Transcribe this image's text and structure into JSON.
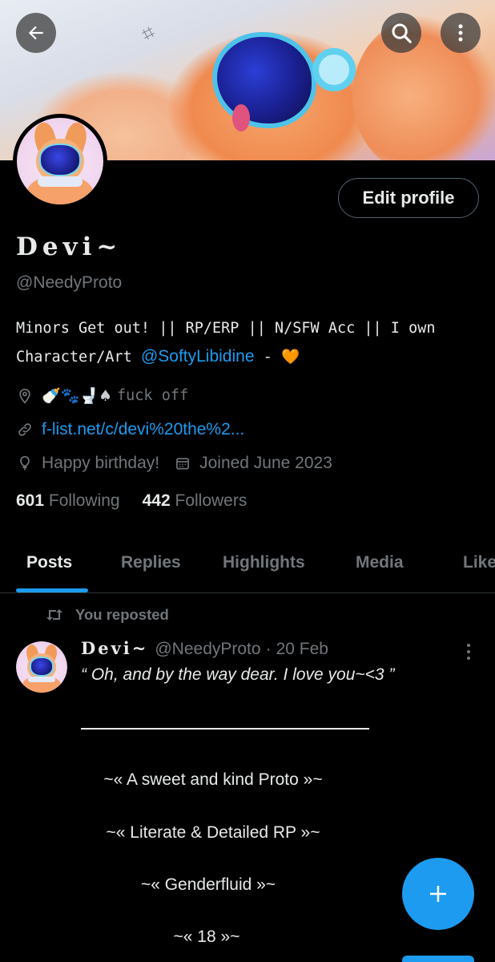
{
  "profile": {
    "display_name": "Devi~",
    "handle": "@NeedyProto",
    "edit_profile_label": "Edit profile",
    "bio_text": "Minors Get out! || RP/ERP || N/SFW Acc || I own Character/Art",
    "bio_mention": "@SoftyLibidine",
    "bio_trailing": " - ",
    "bio_heart": "🧡",
    "location_emoji": "🍼🐾🚽♠",
    "location_text": "fuck off",
    "website": "f-list.net/c/devi%20the%2...",
    "birthday": "Happy birthday!",
    "joined": "Joined June 2023",
    "following_count": "601",
    "following_label": "Following",
    "followers_count": "442",
    "followers_label": "Followers"
  },
  "tabs": [
    {
      "label": "Posts",
      "active": true
    },
    {
      "label": "Replies",
      "active": false
    },
    {
      "label": "Highlights",
      "active": false
    },
    {
      "label": "Media",
      "active": false
    },
    {
      "label": "Like",
      "active": false
    }
  ],
  "post": {
    "repost_label": "You reposted",
    "author_name": "Devi~",
    "author_handle": "@NeedyProto",
    "separator": "·",
    "date": "20 Feb",
    "line1": "“ Oh, and by the way dear. I love you~<3 ”",
    "lines": [
      "~« A sweet and kind Proto »~",
      "~« Literate & Detailed RP »~",
      "~« Genderfluid »~",
      "~« 18 »~"
    ]
  },
  "colors": {
    "accent": "#1d9bf0",
    "background": "#000000",
    "text_primary": "#e7e9ea",
    "text_secondary": "#71767b"
  },
  "icons": {
    "back": "arrow-left-icon",
    "search": "search-icon",
    "more": "more-vertical-icon",
    "location": "location-pin-icon",
    "link": "link-icon",
    "birthday": "balloon-icon",
    "calendar": "calendar-icon",
    "repost": "repost-icon",
    "compose": "plus-icon"
  }
}
